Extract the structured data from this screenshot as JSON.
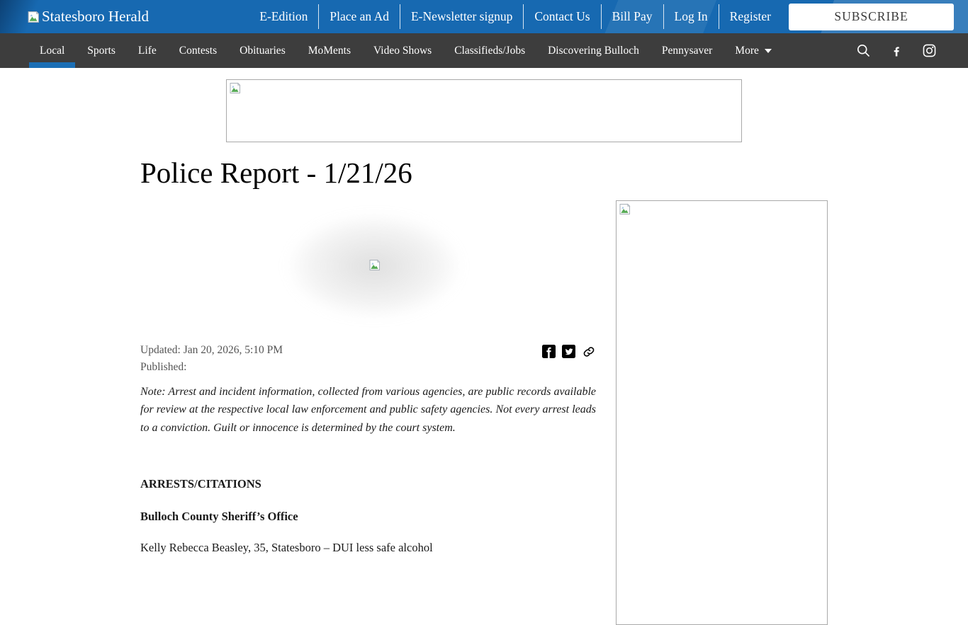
{
  "topbar": {
    "logo_alt": "Statesboro Herald",
    "links": [
      "E-Edition",
      "Place an Ad",
      "E-Newsletter signup",
      "Contact Us",
      "Bill Pay",
      "Log In",
      "Register"
    ],
    "subscribe_label": "SUBSCRIBE"
  },
  "nav": {
    "items": [
      {
        "label": "Local",
        "active": true
      },
      {
        "label": "Sports"
      },
      {
        "label": "Life"
      },
      {
        "label": "Contests"
      },
      {
        "label": "Obituaries"
      },
      {
        "label": "MoMents"
      },
      {
        "label": "Video Shows"
      },
      {
        "label": "Classifieds/Jobs"
      },
      {
        "label": "Discovering Bulloch"
      },
      {
        "label": "Pennysaver"
      },
      {
        "label": "More"
      }
    ],
    "icons": [
      "search-icon",
      "facebook-icon",
      "instagram-icon"
    ]
  },
  "article": {
    "title": "Police Report - 1/21/26",
    "updated": "Updated: Jan 20, 2026, 5:10 PM",
    "published": "Published:",
    "share_icons": [
      "facebook-share-icon",
      "twitter-share-icon",
      "copy-link-icon"
    ],
    "note": "Note: Arrest and incident information, collected from various agencies, are public records available for review at the respective local law enforcement and public safety agencies. Not every arrest leads to a conviction. Guilt or innocence is determined by the court system.",
    "section_heading": "ARRESTS/CITATIONS",
    "agency_heading": "Bulloch County Sheriff’s Office",
    "entries": [
      "Kelly Rebecca Beasley, 35, Statesboro – DUI less safe alcohol"
    ]
  },
  "ads": {
    "placeholder_icon": "broken-image-icon"
  },
  "colors": {
    "topbar_blue": "#1769b1",
    "nav_gray": "#3d3d3d",
    "active_tab_blue": "#1b6fb5",
    "byline_gray": "#555555",
    "ad_border": "#a9a9a9"
  }
}
